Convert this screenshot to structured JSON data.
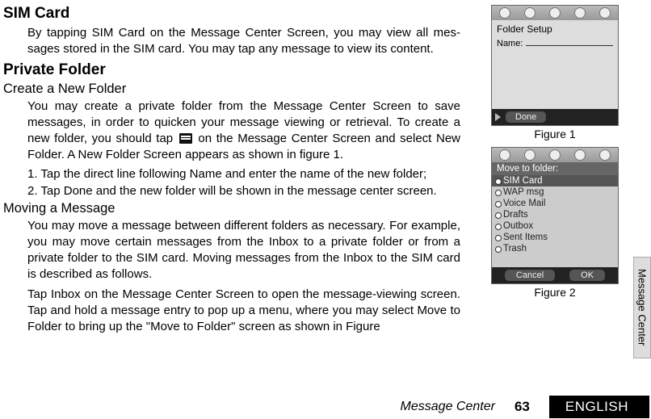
{
  "headings": {
    "sim": "SIM Card",
    "private": "Private Folder",
    "create": "Create a New Folder",
    "moving": "Moving a Message"
  },
  "body": {
    "sim_p": "By tapping SIM Card on the Message Center Screen, you may view all mes­sages stored in the SIM card. You may tap any message to view its content.",
    "create_p": "You may create a private folder from the Message Center Screen to save messages, in order to quicken your message viewing or retrieval. To cre­ate a new folder, you should tap ",
    "create_p_after": " on the Message Center Screen and select New Folder. A New Folder Screen appears as shown in figure 1.",
    "step1": "1.  Tap the direct line following Name and enter the name of the new folder;",
    "step2": "2.  Tap Done and the new folder will be shown in the message center screen.",
    "moving_p1": "You may move a message between different folders as necessary. For exam­ple, you may move certain messages from the Inbox to a private folder or from a private folder to the SIM card. Moving messages from the Inbox to the SIM card is described as follows.",
    "moving_p2": "Tap Inbox on the Message Center Screen to open the message-viewing screen. Tap and hold a message entry to pop up a menu, where you may select Move to Folder to bring up the \"Move to Folder\" screen as shown in Figure"
  },
  "fig1": {
    "title": "Folder Setup",
    "name_label": "Name:",
    "done": "Done",
    "caption": "Figure 1"
  },
  "fig2": {
    "title": "Move to folder:",
    "items": {
      "sim": "SIM Card",
      "wap": "WAP msg",
      "voice": "Voice Mail",
      "drafts": "Drafts",
      "outbox": "Outbox",
      "sent": "Sent Items",
      "trash": "Trash"
    },
    "cancel": "Cancel",
    "ok": "OK",
    "caption": "Figure 2"
  },
  "sidetab": "Message Center",
  "footer": {
    "crumb": "Message Center",
    "page": "63",
    "lang": "ENGLISH"
  }
}
